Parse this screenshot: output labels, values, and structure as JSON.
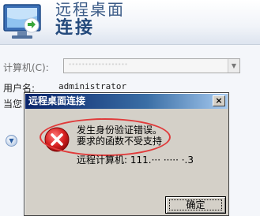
{
  "background_window": {
    "title_line1": "远程桌面",
    "title_line2": "连接",
    "computer_label": "计算机(C):",
    "computer_value": "··················",
    "user_label": "用户名:",
    "user_value": "administrator",
    "prompt_label": "当您",
    "options_button": "▼"
  },
  "dialog": {
    "title": "远程桌面连接",
    "close_label": "×",
    "message_line1": "发生身份验证错误。",
    "message_line2": "要求的函数不受支持",
    "remote_label": "远程计算机: ",
    "remote_value": "111.··· ····· ·.3",
    "ok_label": "确定"
  },
  "colors": {
    "titlebar_start": "#0a246a",
    "titlebar_end": "#a6caf0",
    "error_red": "#d62020",
    "annotation_red": "#e03a3a",
    "dialog_face": "#d4d0c8"
  },
  "icons": [
    "remote-desktop-logo-icon",
    "error-icon",
    "close-icon",
    "options-expand-icon",
    "dropdown-arrow-icon"
  ]
}
